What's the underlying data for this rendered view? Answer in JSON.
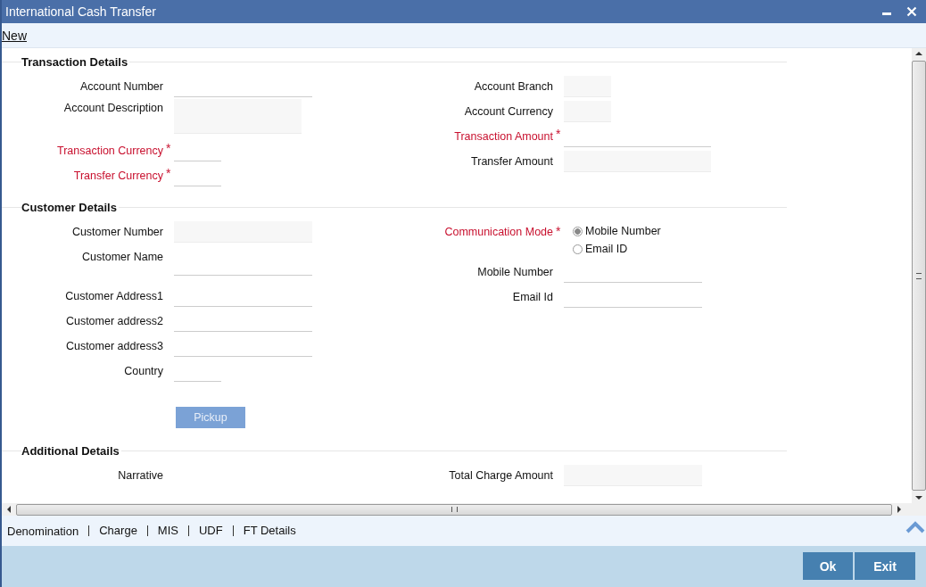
{
  "window": {
    "title": "International Cash Transfer"
  },
  "toolbar": {
    "link": "New"
  },
  "sections": [
    {
      "title": "Transaction Details",
      "left": [
        {
          "label": "Account Number",
          "required": false,
          "kind": "line"
        },
        {
          "label": "Account Description",
          "required": false,
          "kind": "textarea"
        },
        {
          "label": "Transaction Currency",
          "required": true,
          "marker": "*",
          "kind": "short_line"
        },
        {
          "label": "Transfer Currency",
          "required": true,
          "marker": "*",
          "kind": "short_line"
        }
      ],
      "right": [
        {
          "label": "Account Branch",
          "required": false,
          "kind": "short_filled"
        },
        {
          "label": "Account Currency",
          "required": false,
          "kind": "short_filled"
        },
        {
          "label": "Transaction Amount",
          "required": true,
          "marker": "*",
          "kind": "long_line"
        },
        {
          "label": "Transfer Amount",
          "required": false,
          "kind": "long_filled"
        }
      ]
    },
    {
      "title": "Customer Details",
      "left": [
        {
          "label": "Customer Number",
          "required": false,
          "kind": "filled"
        },
        {
          "label": "Customer Name",
          "required": false,
          "kind": "tall_line"
        },
        {
          "label": "Customer Address1",
          "required": false,
          "kind": "line"
        },
        {
          "label": "Customer address2",
          "required": false,
          "kind": "line"
        },
        {
          "label": "Customer address3",
          "required": false,
          "kind": "line"
        },
        {
          "label": "Country",
          "required": false,
          "kind": "short_line"
        },
        {
          "kind": "button",
          "text": "Pickup",
          "disabled": true
        }
      ],
      "right": [
        {
          "label": "Communication Mode",
          "required": true,
          "marker": "*",
          "kind": "radio",
          "options": [
            {
              "label": "Mobile Number",
              "selected": true
            },
            {
              "label": "Email ID",
              "selected": false
            }
          ]
        },
        {
          "label": "Mobile Number",
          "required": false,
          "kind": "line"
        },
        {
          "label": "Email Id",
          "required": false,
          "kind": "line"
        }
      ]
    },
    {
      "title": "Additional Details",
      "left": [
        {
          "label": "Narrative",
          "required": false,
          "kind": "none"
        }
      ],
      "right": [
        {
          "label": "Total Charge Amount",
          "required": false,
          "kind": "filled"
        }
      ]
    }
  ],
  "tabs": [
    "Denomination",
    "Charge",
    "MIS",
    "UDF",
    "FT Details"
  ],
  "buttons": [
    "Ok",
    "Exit"
  ]
}
